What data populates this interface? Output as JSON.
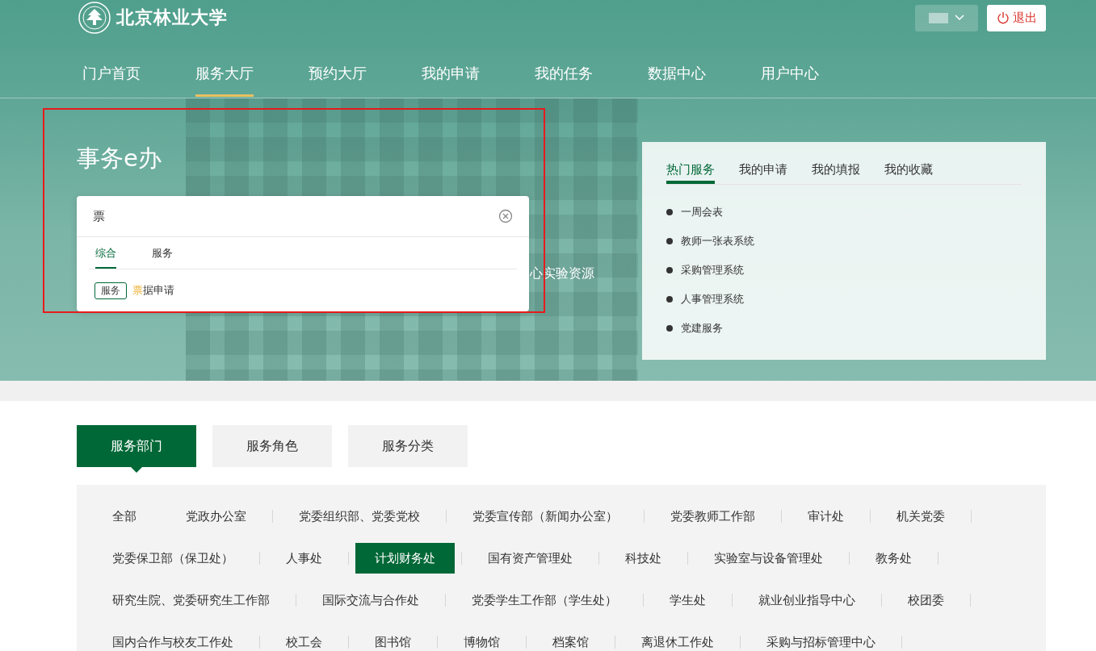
{
  "header": {
    "logo_text": "北京林业大学",
    "logout": "退出"
  },
  "nav": [
    {
      "label": "门户首页",
      "selected": false
    },
    {
      "label": "服务大厅",
      "selected": true
    },
    {
      "label": "预约大厅",
      "selected": false
    },
    {
      "label": "我的申请",
      "selected": false
    },
    {
      "label": "我的任务",
      "selected": false
    },
    {
      "label": "数据中心",
      "selected": false
    },
    {
      "label": "用户中心",
      "selected": false
    }
  ],
  "hero": {
    "title": "事务e办",
    "behind_text": "心实验资源",
    "search": {
      "value": "票",
      "tabs": [
        {
          "label": "综合",
          "selected": true
        },
        {
          "label": "服务",
          "selected": false
        }
      ],
      "results": [
        {
          "tag": "服务",
          "match": "票",
          "rest": "据申请"
        }
      ]
    }
  },
  "quick_panel": {
    "tabs": [
      {
        "label": "热门服务",
        "selected": true
      },
      {
        "label": "我的申请",
        "selected": false
      },
      {
        "label": "我的填报",
        "selected": false
      },
      {
        "label": "我的收藏",
        "selected": false
      }
    ],
    "items": [
      "一周会表",
      "教师一张表系统",
      "采购管理系统",
      "人事管理系统",
      "党建服务"
    ]
  },
  "category_tabs": [
    {
      "label": "服务部门",
      "selected": true
    },
    {
      "label": "服务角色",
      "selected": false
    },
    {
      "label": "服务分类",
      "selected": false
    }
  ],
  "departments": [
    [
      {
        "label": "全部",
        "selected": false
      },
      {
        "label": "党政办公室",
        "selected": false
      },
      {
        "label": "党委组织部、党委党校",
        "selected": false
      },
      {
        "label": "党委宣传部（新闻办公室）",
        "selected": false
      },
      {
        "label": "党委教师工作部",
        "selected": false
      },
      {
        "label": "审计处",
        "selected": false
      },
      {
        "label": "机关党委",
        "selected": false
      }
    ],
    [
      {
        "label": "党委保卫部（保卫处）",
        "selected": false
      },
      {
        "label": "人事处",
        "selected": false
      },
      {
        "label": "计划财务处",
        "selected": true
      },
      {
        "label": "国有资产管理处",
        "selected": false
      },
      {
        "label": "科技处",
        "selected": false
      },
      {
        "label": "实验室与设备管理处",
        "selected": false
      },
      {
        "label": "教务处",
        "selected": false
      }
    ],
    [
      {
        "label": "研究生院、党委研究生工作部",
        "selected": false
      },
      {
        "label": "国际交流与合作处",
        "selected": false
      },
      {
        "label": "党委学生工作部（学生处）",
        "selected": false
      },
      {
        "label": "学生处",
        "selected": false
      },
      {
        "label": "就业创业指导中心",
        "selected": false
      },
      {
        "label": "校团委",
        "selected": false
      }
    ],
    [
      {
        "label": "国内合作与校友工作处",
        "selected": false
      },
      {
        "label": "校工会",
        "selected": false
      },
      {
        "label": "图书馆",
        "selected": false
      },
      {
        "label": "博物馆",
        "selected": false
      },
      {
        "label": "档案馆",
        "selected": false
      },
      {
        "label": "离退休工作处",
        "selected": false
      },
      {
        "label": "采购与招标管理中心",
        "selected": false
      }
    ]
  ]
}
